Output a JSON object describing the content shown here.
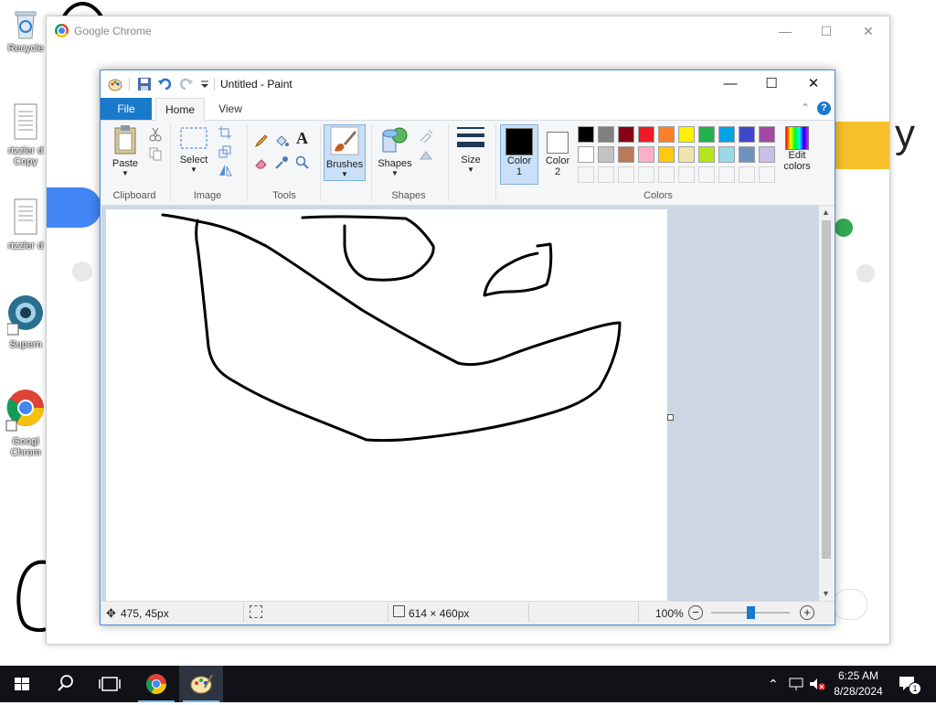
{
  "desktop": {
    "icons": [
      {
        "label": "Recycle"
      },
      {
        "label": "rizzler d",
        "label2": "Copy"
      },
      {
        "label": "rizzler d"
      },
      {
        "label": "Supern"
      },
      {
        "label": "Googl",
        "label2": "Chrom"
      }
    ]
  },
  "chrome": {
    "title": "Google Chrome",
    "partial_text": "y"
  },
  "paint": {
    "title": "Untitled - Paint",
    "tabs": {
      "file": "File",
      "home": "Home",
      "view": "View"
    },
    "ribbon": {
      "clipboard": {
        "paste": "Paste",
        "group": "Clipboard"
      },
      "image": {
        "select": "Select",
        "group": "Image"
      },
      "tools": {
        "group": "Tools"
      },
      "brushes": {
        "label": "Brushes"
      },
      "shapes": {
        "label": "Shapes",
        "group": "Shapes"
      },
      "size": {
        "label": "Size"
      },
      "colors": {
        "color1": "Color",
        "color1_num": "1",
        "color2": "Color",
        "color2_num": "2",
        "edit": "Edit",
        "edit2": "colors",
        "group": "Colors",
        "row1": [
          "#000000",
          "#7f7f7f",
          "#880015",
          "#ed1c24",
          "#ff7f27",
          "#fff200",
          "#22b14c",
          "#00a2e8",
          "#3f48cc",
          "#a349a4"
        ],
        "row2": [
          "#ffffff",
          "#c3c3c3",
          "#b97a57",
          "#ffaec9",
          "#ffc90e",
          "#efe4b0",
          "#b5e61d",
          "#99d9ea",
          "#7092be",
          "#c8bfe7"
        ],
        "color1_value": "#000000",
        "color2_value": "#ffffff"
      }
    },
    "status": {
      "cursor_pos": "475, 45px",
      "canvas_size": "614 × 460px",
      "zoom": "100%",
      "zoom_level": 0.5
    }
  },
  "taskbar": {
    "time": "6:25 AM",
    "date": "8/28/2024",
    "notifications": "1"
  }
}
